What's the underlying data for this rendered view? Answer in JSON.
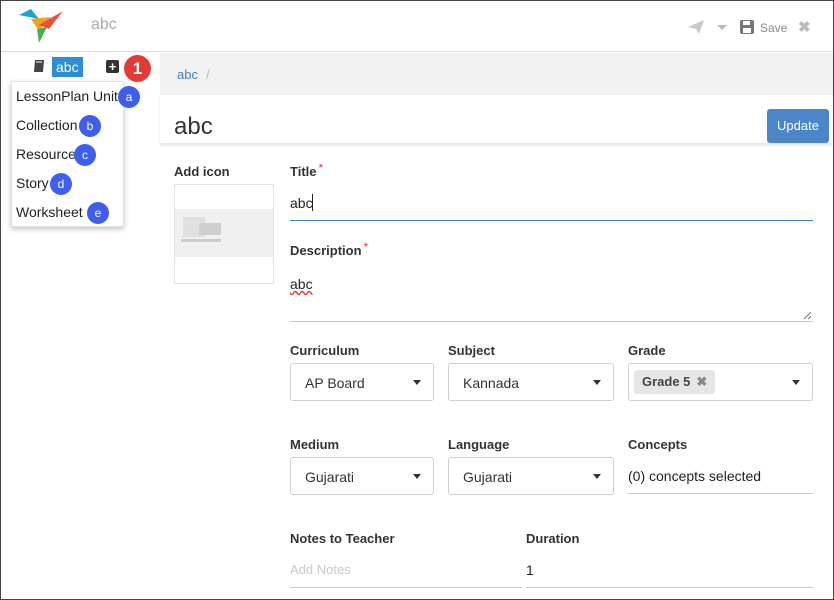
{
  "header": {
    "app_title": "abc",
    "save_label": "Save",
    "close_symbol": "✖",
    "accent": "#2c8fd6"
  },
  "tree": {
    "node_label": "abc",
    "plus_symbol": "+",
    "callout": "1",
    "menu_marker": "L",
    "menu": [
      {
        "label": "LessonPlan Unit",
        "badge": "a"
      },
      {
        "label": "Collection",
        "badge": "b"
      },
      {
        "label": "Resource",
        "badge": "c"
      },
      {
        "label": "Story",
        "badge": "d"
      },
      {
        "label": "Worksheet",
        "badge": "e"
      }
    ]
  },
  "breadcrumb": {
    "item": "abc",
    "separator": "/"
  },
  "page": {
    "title": "abc",
    "update_label": "Update"
  },
  "form": {
    "add_icon_label": "Add icon",
    "title_label": "Title",
    "required_mark": "*",
    "title_value": "abc",
    "description_label": "Description",
    "description_value": "abc",
    "curriculum_label": "Curriculum",
    "curriculum_value": "AP Board",
    "subject_label": "Subject",
    "subject_value": "Kannada",
    "grade_label": "Grade",
    "grade_chip": "Grade 5",
    "chip_remove": "✖",
    "medium_label": "Medium",
    "medium_value": "Gujarati",
    "language_label": "Language",
    "language_value": "Gujarati",
    "concepts_label": "Concepts",
    "concepts_value": "(0) concepts selected",
    "notes_label": "Notes to Teacher",
    "notes_placeholder": "Add Notes",
    "duration_label": "Duration",
    "duration_value": "1"
  }
}
